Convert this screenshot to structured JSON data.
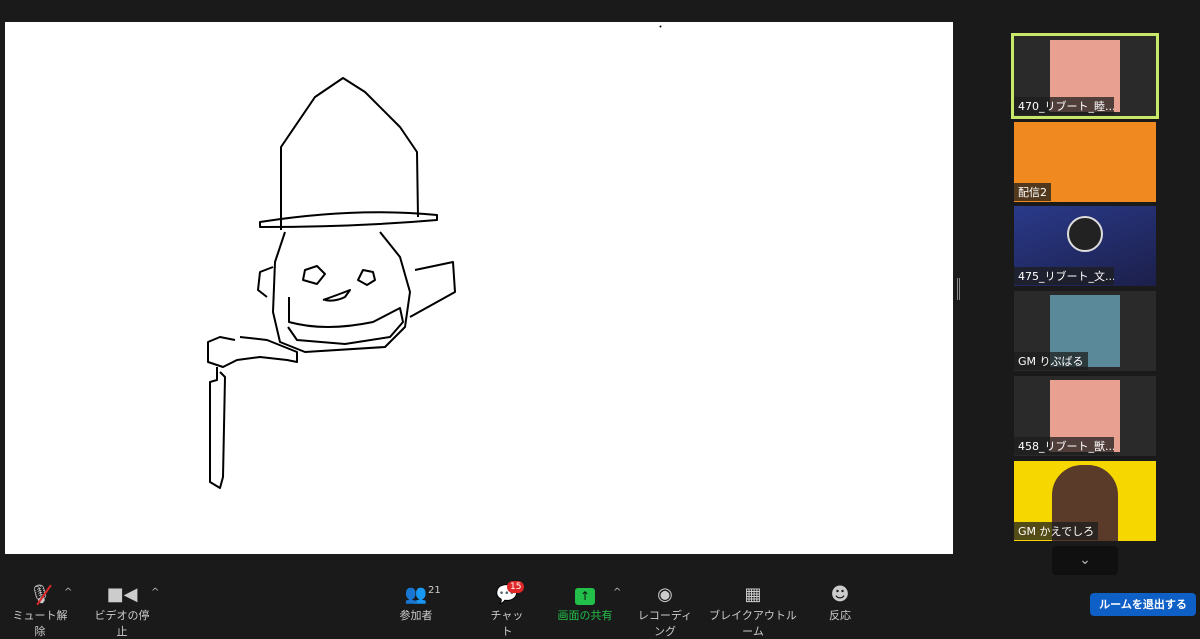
{
  "participants": [
    {
      "name": "470_リブート_睦...",
      "active": true,
      "bg": "#e8a090"
    },
    {
      "name": "配信2",
      "active": false,
      "bg": "#f08a20"
    },
    {
      "name": "475_リブート_文...",
      "active": false,
      "bg": "#26306a"
    },
    {
      "name": "GM りぷばる",
      "active": false,
      "bg": "#5a8a9a"
    },
    {
      "name": "458_リブート_獣...",
      "active": false,
      "bg": "#e8a090"
    },
    {
      "name": "GM かえでしろ",
      "active": false,
      "bg": "#f6d800"
    }
  ],
  "toolbar": {
    "mute": "ミュート解除",
    "video": "ビデオの停止",
    "participants": "参加者",
    "participant_count": "21",
    "chat": "チャット",
    "chat_badge": "15",
    "share": "画面の共有",
    "record": "レコーディング",
    "breakout": "ブレイクアウトルーム",
    "reactions": "反応",
    "leave": "ルームを退出する"
  },
  "colors": {
    "share_green": "#22c04a",
    "leave_blue": "#0e5fc6",
    "active_border": "#c8e86a"
  }
}
